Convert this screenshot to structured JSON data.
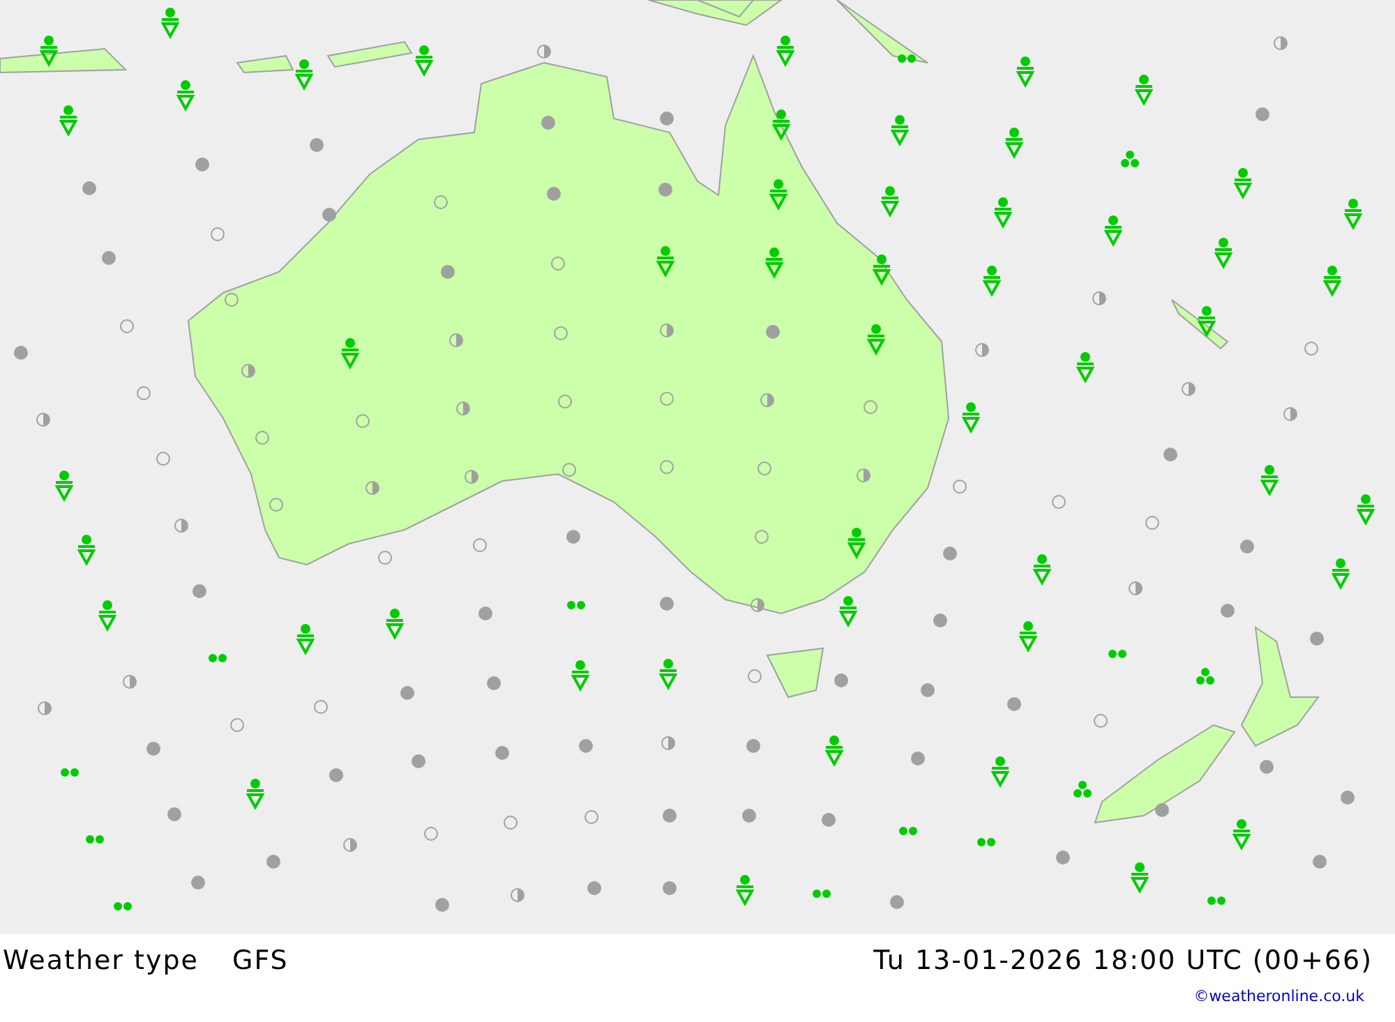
{
  "footer": {
    "title": "Weather type",
    "model": "GFS",
    "valid_time": "Tu 13-01-2026 18:00 UTC (00+66)",
    "credit": "©weatheronline.co.uk"
  }
}
